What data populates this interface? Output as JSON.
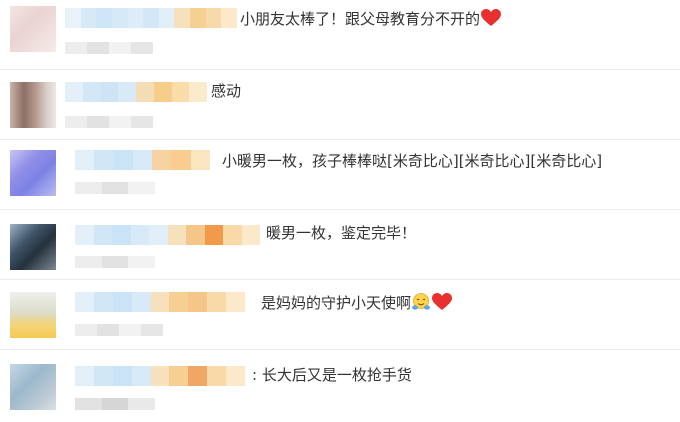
{
  "comments": [
    {
      "text": "小朋友太棒了！跟父母教育分不开的",
      "trailing_icons": [
        "heart-icon"
      ]
    },
    {
      "text": "感动",
      "trailing_icons": []
    },
    {
      "text": "小暖男一枚，孩子棒棒哒[米奇比心][米奇比心][米奇比心]",
      "trailing_icons": []
    },
    {
      "text": "暖男一枚，鉴定完毕！",
      "trailing_icons": []
    },
    {
      "text": "是妈妈的守护小天使啊",
      "trailing_icons": [
        "hug-emoji-icon",
        "heart-icon"
      ]
    },
    {
      "text": ": 长大后又是一枚抢手货",
      "trailing_icons": []
    }
  ],
  "colors": {
    "text": "#333333",
    "divider": "#ececec",
    "heart": "#e8302e",
    "name_blur": "#cfe6f7",
    "highlight_blur": "#f7d79a"
  }
}
